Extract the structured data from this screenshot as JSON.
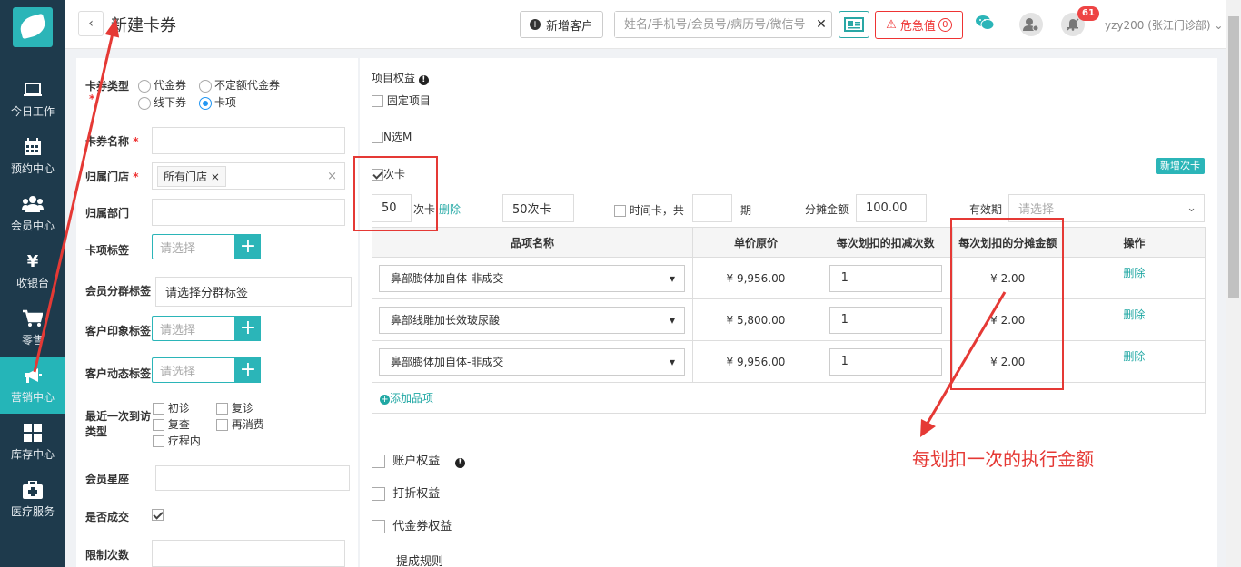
{
  "sidebar": {
    "items": [
      {
        "label": "今日工作",
        "icon": "monitor-icon"
      },
      {
        "label": "预约中心",
        "icon": "calendar-icon"
      },
      {
        "label": "会员中心",
        "icon": "users-icon"
      },
      {
        "label": "收银台",
        "icon": "yen-icon"
      },
      {
        "label": "零售",
        "icon": "cart-icon"
      },
      {
        "label": "营销中心",
        "icon": "megaphone-icon",
        "active": true
      },
      {
        "label": "库存中心",
        "icon": "grid-icon"
      },
      {
        "label": "医疗服务",
        "icon": "medkit-icon"
      }
    ]
  },
  "header": {
    "title": "新建卡券",
    "new_customer": "新增客户",
    "search_placeholder": "姓名/手机号/会员号/病历号/微信号",
    "critical": "危急值",
    "critical_count": "0",
    "badge": "61",
    "user": "yzy200 (张江门诊部)"
  },
  "form": {
    "card_type_label": "卡券类型",
    "card_types": [
      "代金券",
      "不定额代金券",
      "线下券",
      "卡项"
    ],
    "name_label": "卡券名称",
    "store_label": "归属门店",
    "store_tag": "所有门店",
    "dept_label": "归属部门",
    "tag_label": "卡项标签",
    "tag_placeholder": "请选择",
    "group_label": "会员分群标签",
    "group_placeholder": "请选择分群标签",
    "impression_label": "客户印象标签",
    "dynamic_label": "客户动态标签",
    "visit_label": "最近一次到访类型",
    "visit_options": [
      "初诊",
      "复诊",
      "复查",
      "再消费",
      "疗程内"
    ],
    "star_label": "会员星座",
    "deal_label": "是否成交",
    "limit_label": "限制次数"
  },
  "rights": {
    "project_label": "项目权益",
    "fixed": "固定项目",
    "nchoosem": "N选M",
    "times_card": "次卡",
    "add_times_card": "新增次卡",
    "count": "50",
    "count_unit": "次卡",
    "delete": "删除",
    "card_name": "50次卡",
    "time_card": "时间卡，共",
    "period": "期",
    "split_label": "分摊金额",
    "split_value": "100.00",
    "validity_label": "有效期",
    "validity_placeholder": "请选择",
    "table_headers": [
      "品项名称",
      "单价原价",
      "每次划扣的扣减次数",
      "每次划扣的分摊金额",
      "操作"
    ],
    "rows": [
      {
        "name": "鼻部膨体加自体-非成交",
        "price": "¥ 9,956.00",
        "count": "1",
        "amount": "¥ 2.00",
        "action": "删除"
      },
      {
        "name": "鼻部线雕加长效玻尿酸",
        "price": "¥ 5,800.00",
        "count": "1",
        "amount": "¥ 2.00",
        "action": "删除"
      },
      {
        "name": "鼻部膨体加自体-非成交",
        "price": "¥ 9,956.00",
        "count": "1",
        "amount": "¥ 2.00",
        "action": "删除"
      }
    ],
    "add_item": "添加品项",
    "account_rights": "账户权益",
    "discount_rights": "打折权益",
    "voucher_rights": "代金券权益",
    "commission": "提成规则"
  },
  "annotation": "每划扣一次的执行金额",
  "colors": {
    "sidebar": "#1e3a4c",
    "accent": "#2bb5b8",
    "annotation": "#e53935"
  }
}
